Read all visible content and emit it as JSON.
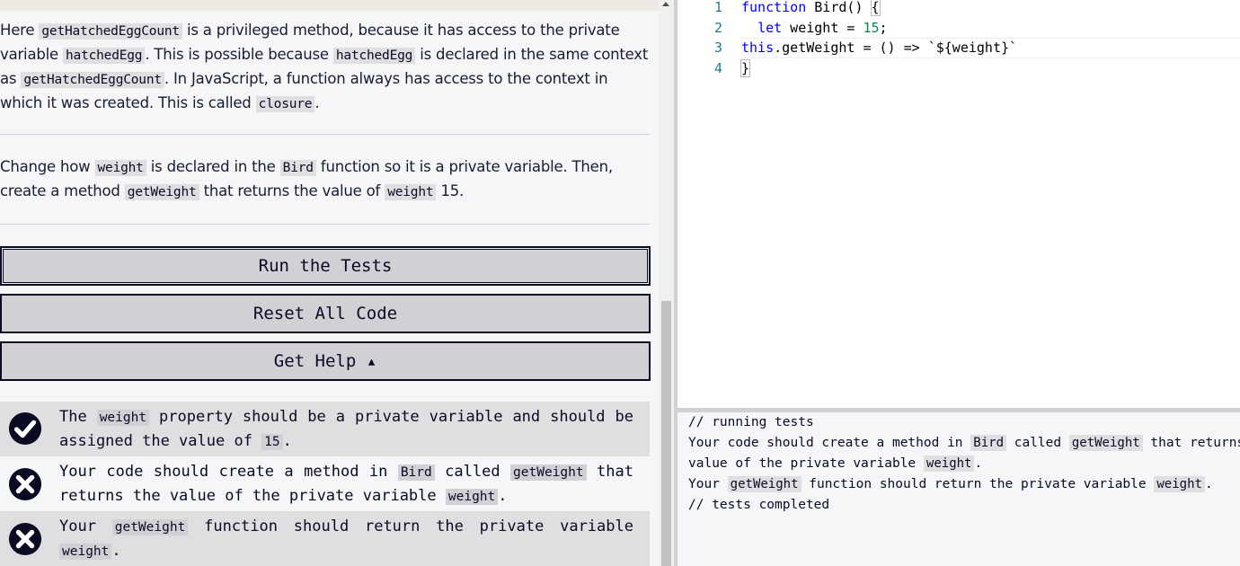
{
  "instructions": {
    "p1": [
      {
        "t": "Here "
      },
      {
        "c": "getHatchedEggCount"
      },
      {
        "t": " is a privileged method, because it has access to the private variable "
      },
      {
        "c": "hatchedEgg"
      },
      {
        "t": ". This is possible because "
      },
      {
        "c": "hatchedEgg"
      },
      {
        "t": " is declared in the same context as "
      },
      {
        "c": "getHatchedEggCount"
      },
      {
        "t": ". In JavaScript, a function always has access to the context in which it was created. This is called "
      },
      {
        "c": "closure"
      },
      {
        "t": "."
      }
    ],
    "p2": [
      {
        "t": "Change how "
      },
      {
        "c": "weight"
      },
      {
        "t": " is declared in the "
      },
      {
        "c": "Bird"
      },
      {
        "t": " function so it is a private variable. Then, create a method "
      },
      {
        "c": "getWeight"
      },
      {
        "t": " that returns the value of "
      },
      {
        "c": "weight"
      },
      {
        "t": " 15."
      }
    ]
  },
  "buttons": {
    "run": "Run the Tests",
    "reset": "Reset All Code",
    "help": "Get Help ▴"
  },
  "tests": [
    {
      "status": "pass",
      "parts": [
        {
          "t": "The "
        },
        {
          "c": "weight"
        },
        {
          "t": " property should be a private variable and should be assigned the value of "
        },
        {
          "c": "15"
        },
        {
          "t": "."
        }
      ]
    },
    {
      "status": "fail",
      "parts": [
        {
          "t": "Your code should create a method in "
        },
        {
          "c": "Bird"
        },
        {
          "t": " called "
        },
        {
          "c": "getWeight"
        },
        {
          "t": " that returns the value of the private variable "
        },
        {
          "c": "weight"
        },
        {
          "t": "."
        }
      ]
    },
    {
      "status": "fail",
      "parts": [
        {
          "t": "Your "
        },
        {
          "c": "getWeight"
        },
        {
          "t": " function should return the private variable "
        },
        {
          "c": "weight"
        },
        {
          "t": "."
        }
      ]
    }
  ],
  "editor": {
    "line_numbers": [
      "1",
      "2",
      "3",
      "4"
    ],
    "lines": [
      [
        {
          "k": "kw",
          "v": "function"
        },
        {
          "v": " Bird() "
        },
        {
          "k": "bracket",
          "v": "{"
        }
      ],
      [
        {
          "v": "  "
        },
        {
          "k": "kw",
          "v": "let"
        },
        {
          "v": " weight = "
        },
        {
          "k": "num",
          "v": "15"
        },
        {
          "v": ";"
        }
      ],
      [
        {
          "k": "kw",
          "v": "this"
        },
        {
          "v": ".getWeight = () => `${weight}`"
        }
      ],
      [
        {
          "k": "bracket",
          "v": "}"
        }
      ]
    ]
  },
  "console": {
    "lines": [
      [
        {
          "t": "// running tests"
        }
      ],
      [
        {
          "t": "Your code should create a method in "
        },
        {
          "c": "Bird"
        },
        {
          "t": " called "
        },
        {
          "c": "getWeight"
        },
        {
          "t": " that returns the"
        }
      ],
      [
        {
          "t": "value of the private variable "
        },
        {
          "c": "weight"
        },
        {
          "t": "."
        }
      ],
      [
        {
          "t": "Your "
        },
        {
          "c": "getWeight"
        },
        {
          "t": " function should return the private variable "
        },
        {
          "c": "weight"
        },
        {
          "t": "."
        }
      ],
      [
        {
          "t": "// tests completed"
        }
      ]
    ]
  },
  "colors": {
    "keyword": "#0000ff",
    "number": "#098658",
    "pass_icon": "#0a0a23",
    "fail_icon": "#0a0a23",
    "button_bg": "#d0d0d5"
  },
  "icons": {
    "pass": "check-circle-icon",
    "fail": "x-circle-icon",
    "help_caret": "caret-up-icon"
  }
}
